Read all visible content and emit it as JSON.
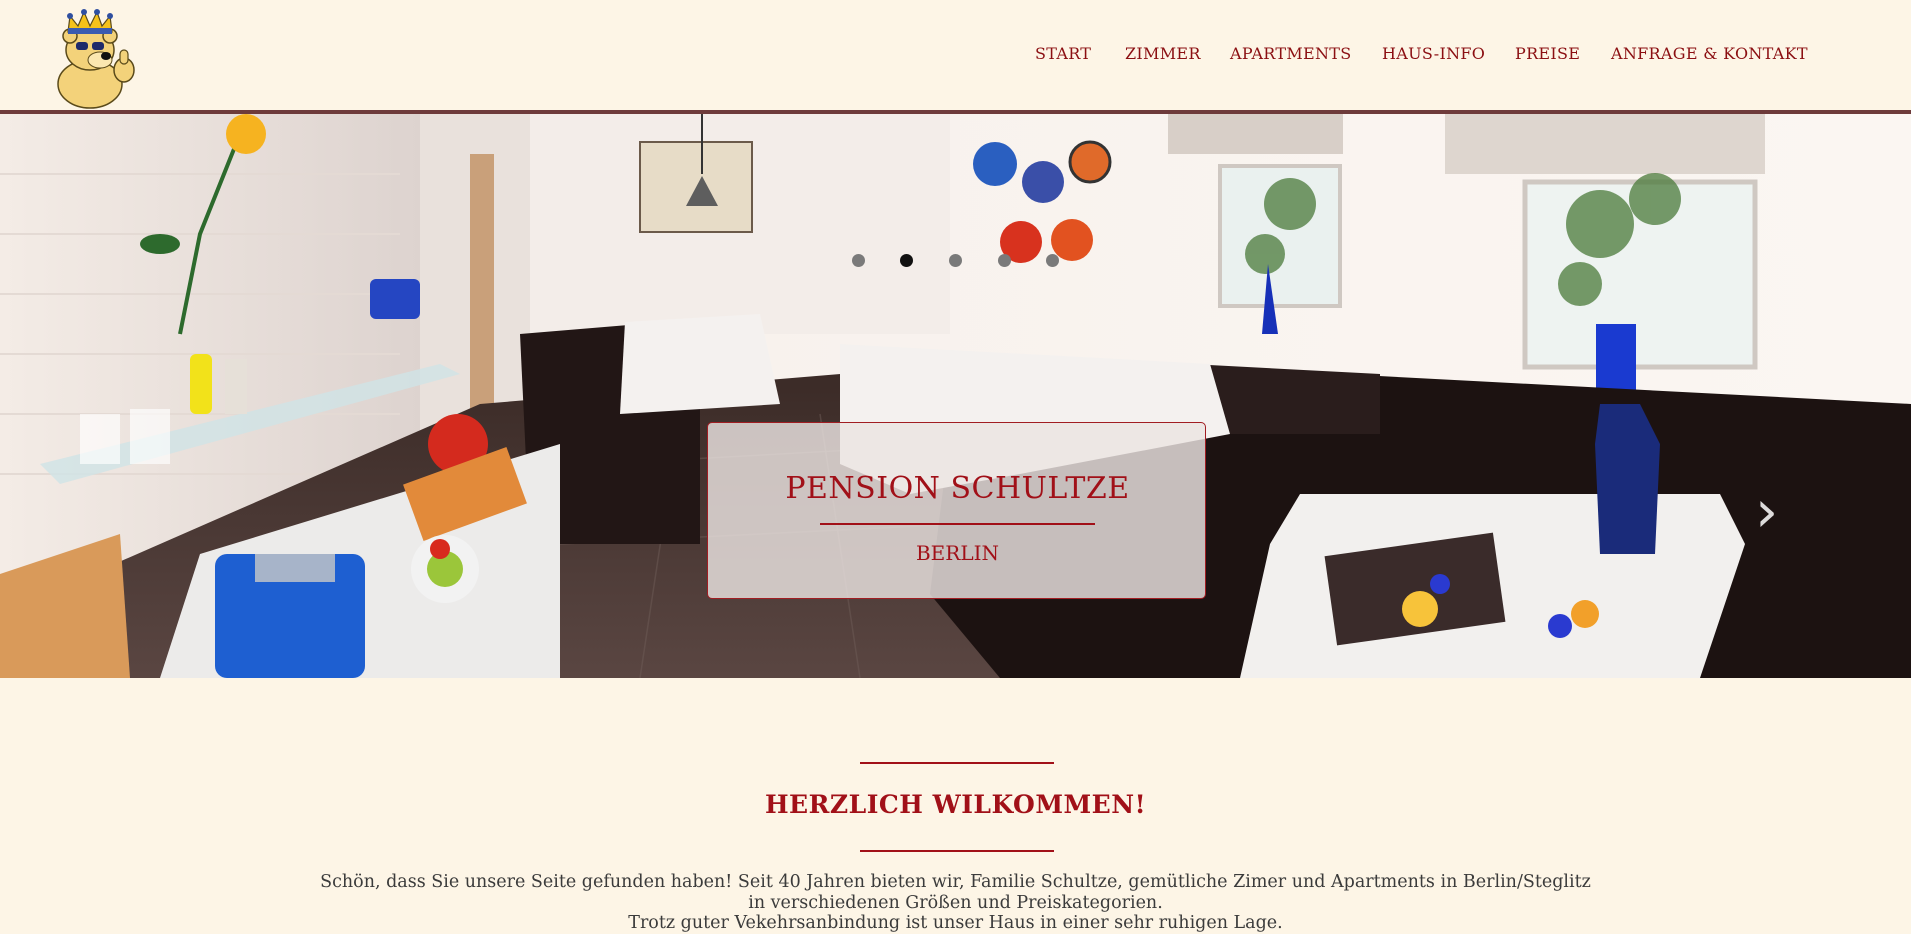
{
  "header": {
    "logo_icon": "king-bear-mascot-icon",
    "nav": [
      {
        "label": "START"
      },
      {
        "label": "ZIMMER"
      },
      {
        "label": "APARTMENTS"
      },
      {
        "label": "HAUS-INFO"
      },
      {
        "label": "PREISE"
      },
      {
        "label": "ANFRAGE & KONTAKT"
      }
    ]
  },
  "slideshow": {
    "slide_count": 5,
    "active_slide": 2,
    "next_icon": "chevron-right-icon",
    "title": "PENSION SCHULTZE",
    "subtitle": "BERLIN"
  },
  "welcome": {
    "heading": "HERZLICH WILKOMMEN!",
    "line1": "Schön, dass Sie unsere Seite gefunden haben! Seit 40 Jahren bieten wir, Familie Schultze, gemütliche Zimer und Apartments in Berlin/Steglitz in verschiedenen Größen und Preiskategorien.",
    "line2": "Trotz guter Vekehrsanbindung ist unser Haus in einer sehr ruhigen Lage."
  },
  "colors": {
    "background": "#fdf5e6",
    "accent": "#a11018",
    "header_rule": "#6e3b3b"
  }
}
